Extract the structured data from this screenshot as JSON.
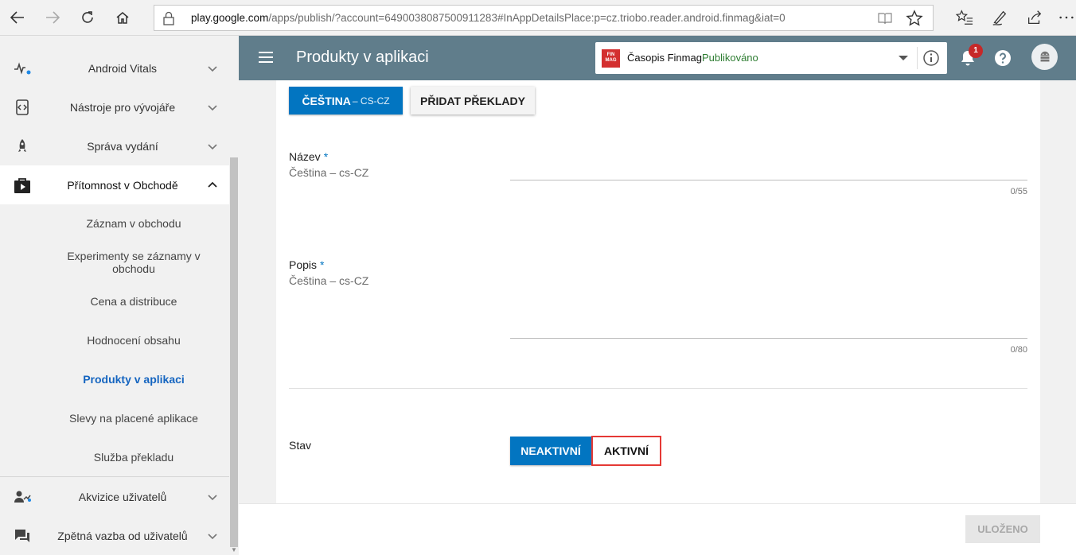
{
  "browser": {
    "url_domain": "play.google.com",
    "url_path": "/apps/publish/?account=6490038087500911283#InAppDetailsPlace:p=cz.triobo.reader.android.finmag&iat=0"
  },
  "sidebar": {
    "items": [
      {
        "label": "Android Vitals",
        "icon": "vitals-icon"
      },
      {
        "label": "Nástroje pro vývojáře",
        "icon": "dev-tools-icon"
      },
      {
        "label": "Správa vydání",
        "icon": "rocket-icon"
      },
      {
        "label": "Přítomnost v Obchodě",
        "icon": "store-icon"
      },
      {
        "label": "Akvizice uživatelů",
        "icon": "user-acquisition-icon"
      },
      {
        "label": "Zpětná vazba od uživatelů",
        "icon": "feedback-icon"
      }
    ],
    "sub_items": [
      {
        "label": "Záznam v obchodu"
      },
      {
        "label": "Experimenty se záznamy v obchodu"
      },
      {
        "label": "Cena a distribuce"
      },
      {
        "label": "Hodnocení obsahu"
      },
      {
        "label": "Produkty v aplikaci"
      },
      {
        "label": "Slevy na placené aplikace"
      },
      {
        "label": "Služba překladu"
      }
    ]
  },
  "header": {
    "title": "Produkty v aplikaci",
    "app_logo_text": "FIN MAG",
    "app_name": "Časopis Finmag",
    "app_status": "Publikováno",
    "notification_count": "1"
  },
  "language": {
    "selected_label": "ČEŠTINA",
    "selected_code": " – CS-CZ",
    "add_translations_label": "PŘIDAT PŘEKLADY"
  },
  "form": {
    "name_label": "Název",
    "name_sub": "Čeština – cs-CZ",
    "name_counter": "0/55",
    "description_label": "Popis",
    "description_sub": "Čeština – cs-CZ",
    "description_counter": "0/80",
    "required_mark": "*",
    "status_label": "Stav",
    "inactive_label": "NEAKTIVNÍ",
    "active_label": "AKTIVNÍ"
  },
  "footer": {
    "save_label": "ULOŽENO"
  },
  "colors": {
    "header_bg": "#607d8b",
    "primary": "#0275c1",
    "active_link": "#1565c0",
    "highlight_border": "#e53935",
    "status_green": "#2e7d32"
  }
}
